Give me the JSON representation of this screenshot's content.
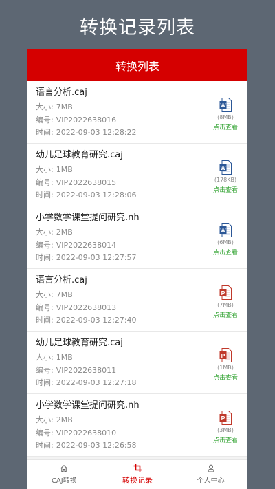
{
  "title": "转换记录列表",
  "panel_header": "转换列表",
  "labels": {
    "size": "大小:",
    "number": "编号:",
    "time": "时间:",
    "view": "点击查看"
  },
  "records": [
    {
      "name": "语言分析.caj",
      "size": "7MB",
      "number": "VIP2022638016",
      "time": "2022-09-03 12:28:22",
      "file_type": "word",
      "file_size": "(8MB)"
    },
    {
      "name": "幼儿足球教育研究.caj",
      "size": "1MB",
      "number": "VIP2022638015",
      "time": "2022-09-03 12:28:06",
      "file_type": "word",
      "file_size": "(178KB)"
    },
    {
      "name": "小学数学课堂提问研究.nh",
      "size": "2MB",
      "number": "VIP2022638014",
      "time": "2022-09-03 12:27:57",
      "file_type": "word",
      "file_size": "(6MB)"
    },
    {
      "name": "语言分析.caj",
      "size": "7MB",
      "number": "VIP2022638013",
      "time": "2022-09-03 12:27:40",
      "file_type": "pdf",
      "file_size": "(7MB)"
    },
    {
      "name": "幼儿足球教育研究.caj",
      "size": "1MB",
      "number": "VIP2022638011",
      "time": "2022-09-03 12:27:18",
      "file_type": "pdf",
      "file_size": "(1MB)"
    },
    {
      "name": "小学数学课堂提问研究.nh",
      "size": "2MB",
      "number": "VIP2022638010",
      "time": "2022-09-03 12:26:58",
      "file_type": "pdf",
      "file_size": "(3MB)"
    }
  ],
  "tabs": [
    {
      "label": "CAJ转换",
      "icon": "home-icon",
      "active": false
    },
    {
      "label": "转换记录",
      "icon": "crop-icon",
      "active": true
    },
    {
      "label": "个人中心",
      "icon": "person-icon",
      "active": false
    }
  ],
  "colors": {
    "accent": "#d50000",
    "link": "#2ea12e",
    "word": "#2b5797",
    "pdf": "#c0392b",
    "background": "#5d6773"
  }
}
